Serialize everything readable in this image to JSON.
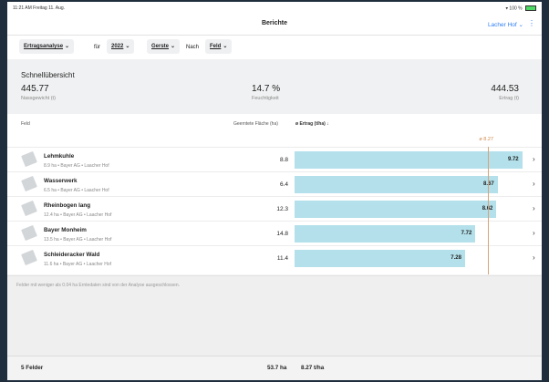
{
  "status_bar": {
    "time": "11:21 AM  Freitag 11. Aug.",
    "indicators": "100 %"
  },
  "nav": {
    "title": "Berichte",
    "org": "Lacher Hof",
    "more_icon": "vertical-dots-icon"
  },
  "filters": {
    "analysis": "Ertragsanalyse",
    "word_for": "für",
    "year": "2022",
    "crop": "Gerste",
    "word_by": "Nach",
    "group": "Feld"
  },
  "summary": {
    "title": "Schnellübersicht",
    "wet_weight_value": "445.77",
    "wet_weight_label": "Nassgewicht (t)",
    "moisture_value": "14.7 %",
    "moisture_label": "Feuchtigkeit",
    "yield_value": "444.53",
    "yield_label": "Ertrag (t)"
  },
  "columns": {
    "field": "Feld",
    "area": "Geerntete Fläche (ha)",
    "yield": "ø Ertrag (t/ha) ↓"
  },
  "average_label": "ø 8.27",
  "chart_data": {
    "type": "bar",
    "categories": [
      "Lehmkuhle",
      "Wasserwerk",
      "Rheinbogen lang",
      "Bayer Monheim",
      "Schleideracker Wald"
    ],
    "values": [
      9.72,
      8.67,
      8.62,
      7.72,
      7.28
    ],
    "average": 8.27,
    "xlim": [
      0,
      10.2
    ]
  },
  "rows": [
    {
      "name": "Lehmkuhle",
      "sub": "8.9 ha • Bayer AG • Laacher Hof",
      "area": "8.8",
      "yield": "9.72"
    },
    {
      "name": "Wasserwerk",
      "sub": "6.5 ha • Bayer AG • Laacher Hof",
      "area": "6.4",
      "yield": "8.67"
    },
    {
      "name": "Rheinbogen lang",
      "sub": "12.4 ha • Bayer AG • Laacher Hof",
      "area": "12.3",
      "yield": "8.62"
    },
    {
      "name": "Bayer Monheim",
      "sub": "13.5 ha • Bayer AG • Laacher Hof",
      "area": "14.8",
      "yield": "7.72"
    },
    {
      "name": "Schleideracker Wald",
      "sub": "11.6 ha • Bayer AG • Laacher Hof",
      "area": "11.4",
      "yield": "7.28"
    }
  ],
  "note": "Felder mit weniger als 0.04 ha Erntedaten sind von der Analyse ausgeschlossen.",
  "footer": {
    "count": "5 Felder",
    "area_total": "53.7 ha",
    "yield_avg": "8.27 t/ha"
  },
  "colors": {
    "bar": "#b3e0ea",
    "average_line": "#d8a27a",
    "accent": "#2f7df6"
  }
}
